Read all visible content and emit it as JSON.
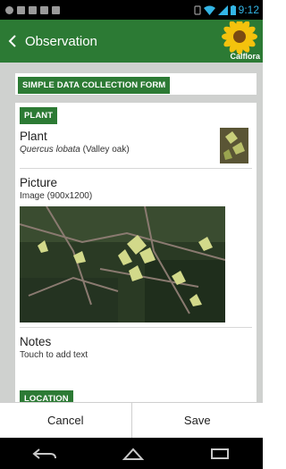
{
  "status_bar": {
    "time": "9:12"
  },
  "app_bar": {
    "title": "Observation",
    "logo_text": "Calflora"
  },
  "form": {
    "form_title": "SIMPLE DATA COLLECTION FORM",
    "plant_section": "PLANT",
    "plant": {
      "label": "Plant",
      "scientific_name": "Quercus lobata",
      "common_name": "(Valley oak)"
    },
    "picture": {
      "label": "Picture",
      "info": "Image (900x1200)"
    },
    "notes": {
      "label": "Notes",
      "hint": "Touch to add text"
    },
    "location_section": "LOCATION"
  },
  "actions": {
    "cancel": "Cancel",
    "save": "Save"
  },
  "colors": {
    "brand_green": "#2c7a34",
    "background_gray": "#cfd1cf",
    "status_accent": "#33b5e5"
  }
}
